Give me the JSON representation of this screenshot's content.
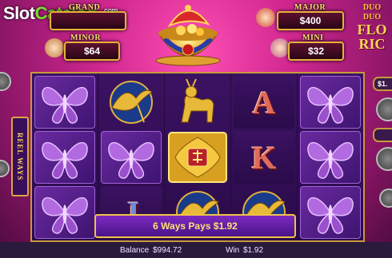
{
  "watermark": {
    "slot": "Slot",
    "catalog": "Catalog",
    "com": ".com"
  },
  "game_title": {
    "line1": "DUO",
    "line2": "DUO",
    "line3": "FLO",
    "line4": "RIC"
  },
  "jackpots": {
    "grand": {
      "label": "GRAND",
      "value": ""
    },
    "major": {
      "label": "MAJOR",
      "value": "$400"
    },
    "minor": {
      "label": "MINOR",
      "value": "$64"
    },
    "mini": {
      "label": "MINI",
      "value": "$32"
    }
  },
  "side_label": "REEL WAYS",
  "right_pill": "$1.",
  "reels": [
    [
      "butterfly",
      "butterfly",
      "butterfly"
    ],
    [
      "crane",
      "butterfly",
      "J"
    ],
    [
      "deer",
      "gold-fu",
      "crane"
    ],
    [
      "A",
      "K",
      "crane"
    ],
    [
      "butterfly",
      "butterfly",
      "butterfly"
    ]
  ],
  "win_banner": "6 Ways Pays $1.92",
  "balance": {
    "label": "Balance",
    "value": "$994.72"
  },
  "win": {
    "label": "Win",
    "value": "$1.92"
  },
  "colors": {
    "accent_gold": "#e8b23a",
    "banner_purple": "#5a1a9c",
    "logo_green": "#7be02e"
  }
}
